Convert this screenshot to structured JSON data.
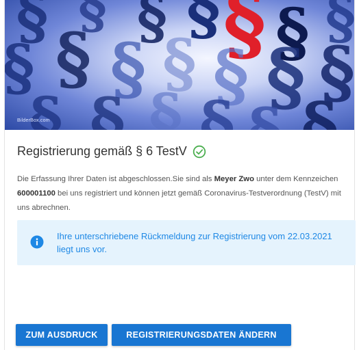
{
  "hero": {
    "watermark": "BilderBox.com",
    "icon": "paragraph-pattern"
  },
  "card": {
    "title": "Registrierung gemäß § 6 TestV",
    "status_icon": "check-circle-icon",
    "description": {
      "part1": "Die Erfassung Ihrer Daten ist abgeschlossen.Sie sind als ",
      "name": "Meyer Zwo",
      "part2": " unter dem Kennzeichen ",
      "id": "600001100",
      "part3": " bei uns registriert und können jetzt gemäß Coronavirus-Testverordnung (TestV) mit uns abrechnen."
    },
    "notice": {
      "icon": "info-icon",
      "text": "Ihre unterschriebene Rückmeldung zur Registrierung vom 22.03.2021 liegt uns vor."
    }
  },
  "actions": {
    "print_label": "ZUM AUSDRUCK",
    "edit_label": "REGISTRIERUNGSDATEN ÄNDERN"
  },
  "colors": {
    "primary": "#1976d2",
    "notice_bg": "#e5f3fd",
    "notice_text": "#1e88e5",
    "success": "#4caf50",
    "accent_red": "#e0202a"
  }
}
